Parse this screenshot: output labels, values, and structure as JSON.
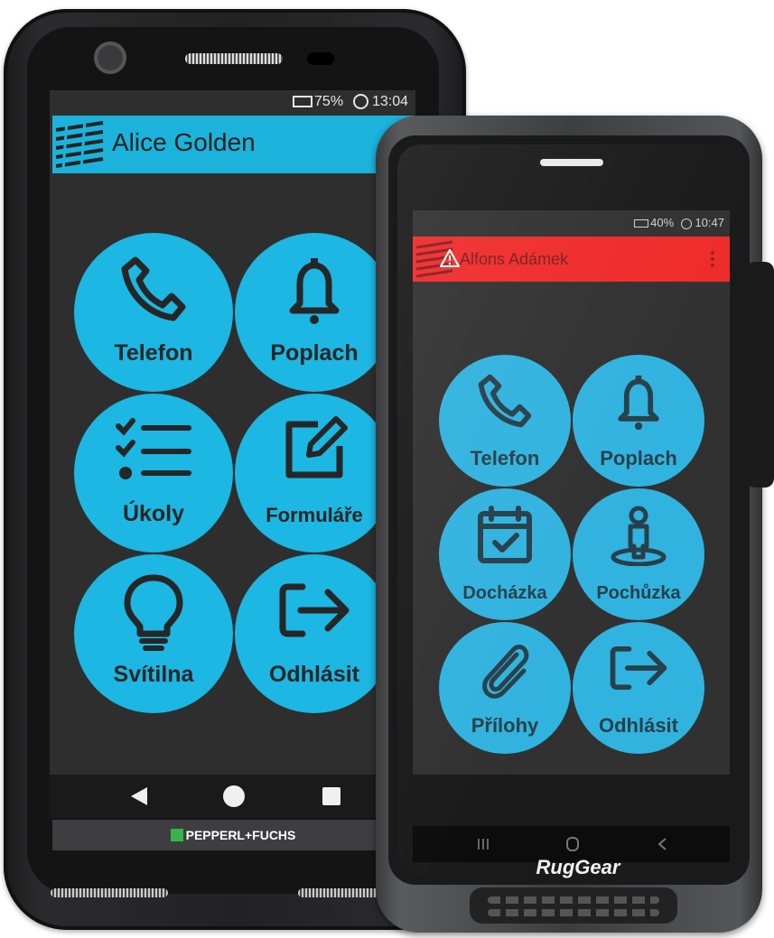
{
  "phone1": {
    "status": {
      "battery": "75%",
      "time": "13:04"
    },
    "title": "Alice Golden",
    "tiles": [
      {
        "label": "Telefon",
        "icon": "phone-icon"
      },
      {
        "label": "Poplach",
        "icon": "bell-icon"
      },
      {
        "label": "Úkoly",
        "icon": "checklist-icon"
      },
      {
        "label": "Formuláře",
        "icon": "edit-icon"
      },
      {
        "label": "Svítilna",
        "icon": "lightbulb-icon"
      },
      {
        "label": "Odhlásit",
        "icon": "logout-icon"
      }
    ],
    "nav": [
      "back-icon",
      "home-icon",
      "recents-icon"
    ],
    "brand": "PEPPERL+FUCHS"
  },
  "phone2": {
    "status": {
      "battery": "40%",
      "time": "10:47"
    },
    "title": "Alfons Adámek",
    "tiles": [
      {
        "label": "Telefon",
        "icon": "phone-icon"
      },
      {
        "label": "Poplach",
        "icon": "bell-icon"
      },
      {
        "label": "Docházka",
        "icon": "calendar-check-icon"
      },
      {
        "label": "Pochůzka",
        "icon": "person-location-icon"
      },
      {
        "label": "Přílohy",
        "icon": "paperclip-icon"
      },
      {
        "label": "Odhlásit",
        "icon": "logout-icon"
      }
    ],
    "nav": [
      "recents-icon",
      "home-icon",
      "back-icon"
    ],
    "brand": "RugGear"
  },
  "colors": {
    "tile": "#1cb7e2",
    "title_bar_1": "#1bb3dc",
    "title_bar_2": "#ef2b2b"
  }
}
